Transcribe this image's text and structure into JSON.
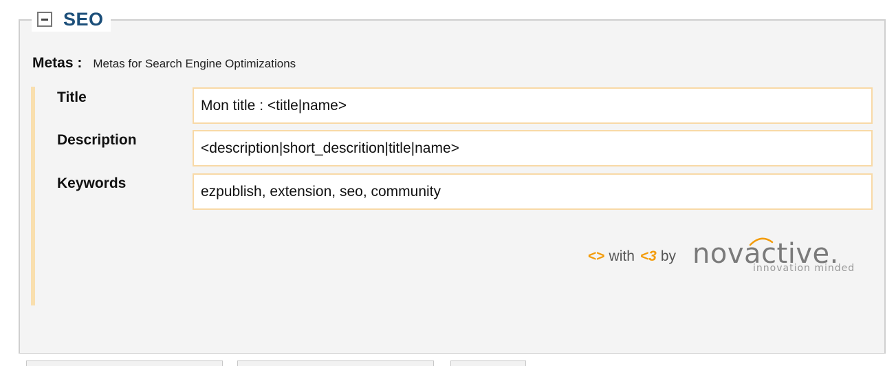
{
  "fieldset": {
    "legend": "SEO",
    "toggle_icon": "minus-square-icon"
  },
  "metas": {
    "label": "Metas :",
    "description": "Metas for Search Engine Optimizations"
  },
  "fields": [
    {
      "label": "Title",
      "value": "Mon title : <title|name>"
    },
    {
      "label": "Description",
      "value": "<description|short_descrition|title|name>"
    },
    {
      "label": "Keywords",
      "value": "ezpublish, extension, seo, community"
    }
  ],
  "credit": {
    "code_symbol": "<>",
    "with": "with",
    "heart_symbol": "<3",
    "by": "by",
    "logo_text_1": "nov",
    "logo_text_2": "a",
    "logo_text_3": "ctive.",
    "logo_tagline": "innovation minded"
  },
  "colors": {
    "accent_orange": "#f39c0a",
    "legend_blue": "#1c4f7a",
    "input_border": "#f8d9a6",
    "side_bar": "#f9dfae"
  }
}
